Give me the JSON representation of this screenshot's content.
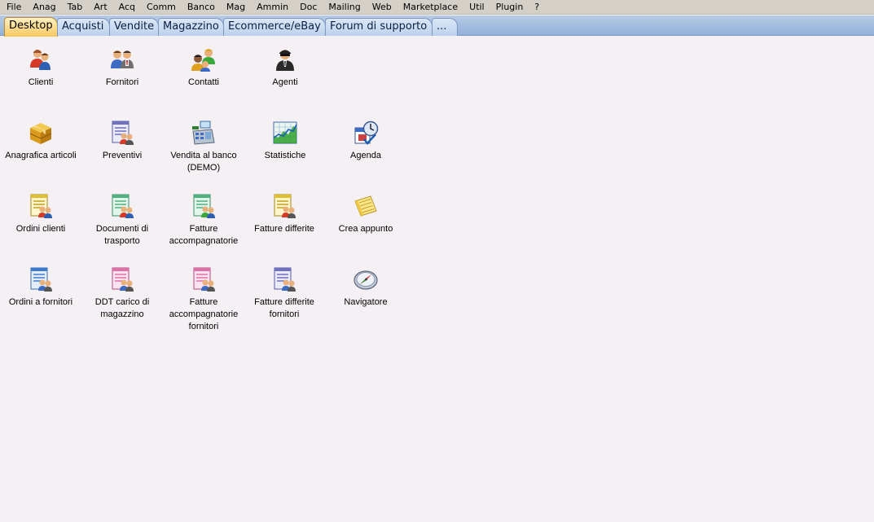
{
  "menu": [
    "File",
    "Anag",
    "Tab",
    "Art",
    "Acq",
    "Comm",
    "Banco",
    "Mag",
    "Ammin",
    "Doc",
    "Mailing",
    "Web",
    "Marketplace",
    "Util",
    "Plugin",
    "?"
  ],
  "tabs": [
    {
      "label": "Desktop",
      "active": true
    },
    {
      "label": "Acquisti",
      "active": false
    },
    {
      "label": "Vendite",
      "active": false
    },
    {
      "label": "Magazzino",
      "active": false
    },
    {
      "label": "Ecommerce/eBay",
      "active": false
    },
    {
      "label": "Forum di supporto",
      "active": false
    },
    {
      "label": "...",
      "active": false
    }
  ],
  "desktop": {
    "icons": [
      {
        "label": "Clienti",
        "icon": "clients-icon"
      },
      {
        "label": "Fornitori",
        "icon": "suppliers-icon"
      },
      {
        "label": "Contatti",
        "icon": "contacts-icon"
      },
      {
        "label": "Agenti",
        "icon": "agents-icon"
      },
      {
        "label": "Anagrafica articoli",
        "icon": "products-box-icon"
      },
      {
        "label": "Preventivi",
        "icon": "quotes-doc-icon"
      },
      {
        "label": "Vendita al banco (DEMO)",
        "icon": "cash-register-icon"
      },
      {
        "label": "Statistiche",
        "icon": "statistics-chart-icon"
      },
      {
        "label": "Agenda",
        "icon": "agenda-clock-icon"
      },
      {
        "label": "Ordini clienti",
        "icon": "customer-orders-doc-icon"
      },
      {
        "label": "Documenti di trasporto",
        "icon": "transport-doc-icon"
      },
      {
        "label": "Fatture accompagnatorie",
        "icon": "accompanying-invoice-doc-icon"
      },
      {
        "label": "Fatture differite",
        "icon": "deferred-invoice-doc-icon"
      },
      {
        "label": "Crea appunto",
        "icon": "note-pad-icon"
      },
      {
        "label": "Ordini a fornitori",
        "icon": "supplier-orders-doc-icon"
      },
      {
        "label": "DDT carico di magazzino",
        "icon": "warehouse-ddt-doc-icon"
      },
      {
        "label": "Fatture accompagnatorie fornitori",
        "icon": "supplier-accompanying-invoice-doc-icon"
      },
      {
        "label": "Fatture differite fornitori",
        "icon": "supplier-deferred-invoice-doc-icon"
      },
      {
        "label": "Navigatore",
        "icon": "compass-navigator-icon"
      }
    ]
  }
}
